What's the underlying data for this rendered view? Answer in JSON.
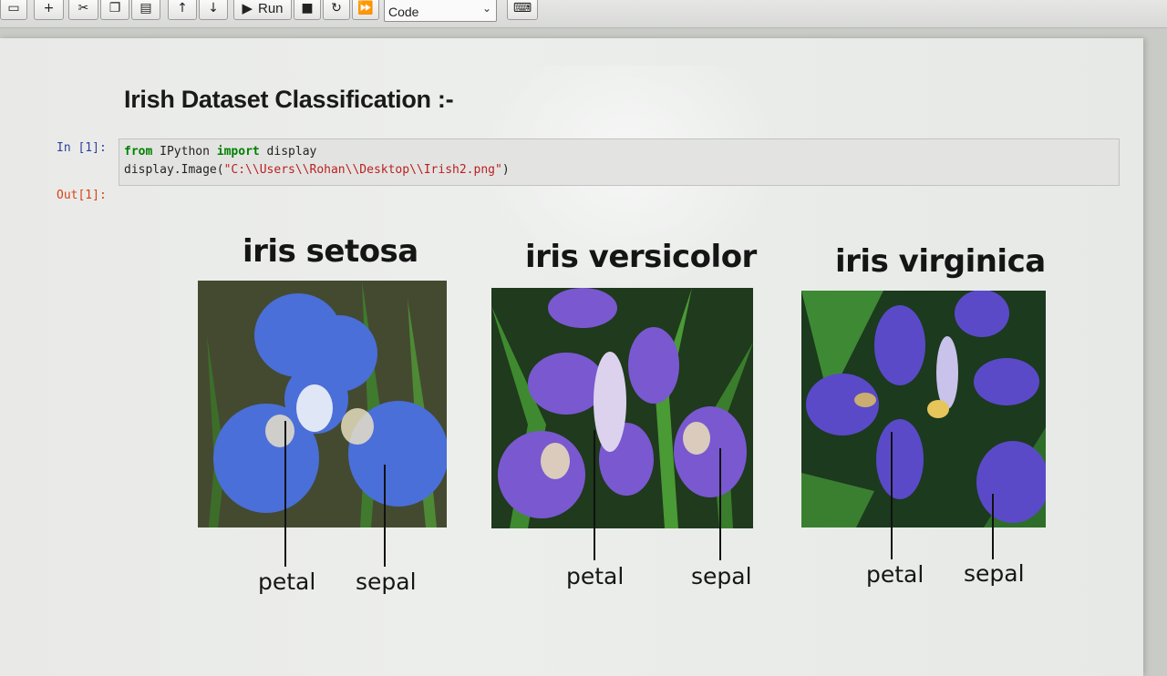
{
  "toolbar": {
    "icons": [
      "save-icon",
      "add-cell-icon",
      "cut-icon",
      "copy-icon",
      "paste-icon",
      "move-up-icon",
      "move-down-icon",
      "stop-icon",
      "restart-icon",
      "fast-forward-icon",
      "keyboard-icon"
    ],
    "run_label": "Run",
    "cell_type": "Code"
  },
  "notebook": {
    "heading": "Irish Dataset Classification :-",
    "in_prompt": "In [1]:",
    "code_line1": {
      "kw1": "from",
      "t1": " IPython ",
      "kw2": "import",
      "t2": " display"
    },
    "code_line2": {
      "t1": "display.Image(",
      "str": "\"C:\\\\Users\\\\Rohan\\\\Desktop\\\\Irish2.png\"",
      "t2": ")"
    },
    "out_prompt": "Out[1]:"
  },
  "figure": {
    "flowers": [
      {
        "name": "iris setosa",
        "petal_label": "petal",
        "sepal_label": "sepal",
        "color": "#4a6fd8"
      },
      {
        "name": "iris versicolor",
        "petal_label": "petal",
        "sepal_label": "sepal",
        "color": "#7a58d0"
      },
      {
        "name": "iris virginica",
        "petal_label": "petal",
        "sepal_label": "sepal",
        "color": "#5a4ac8"
      }
    ]
  },
  "colors": {
    "in_prompt": "#303f9f",
    "out_prompt": "#d84315",
    "keyword": "#008000",
    "string": "#ba2121"
  }
}
